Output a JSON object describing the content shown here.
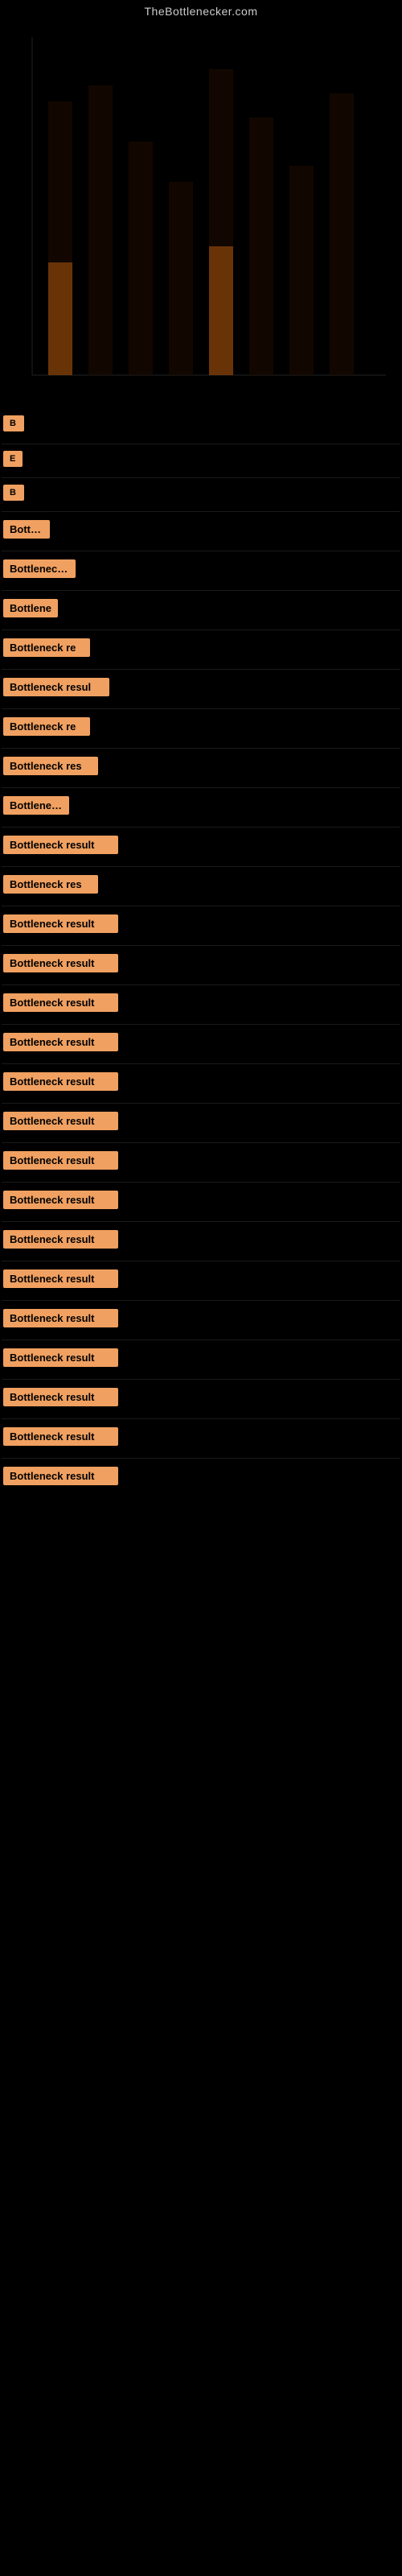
{
  "header": {
    "site_title": "TheBottlenecker.com"
  },
  "results": [
    {
      "id": 1,
      "label": "B",
      "width": 30,
      "visible_text": "B"
    },
    {
      "id": 2,
      "label": "E",
      "width": 28,
      "visible_text": "E"
    },
    {
      "id": 3,
      "label": "B",
      "width": 30,
      "visible_text": "B"
    },
    {
      "id": 4,
      "label": "Bottlen",
      "width": 60,
      "visible_text": "Bottlen"
    },
    {
      "id": 5,
      "label": "Bottleneck r",
      "width": 90,
      "visible_text": "Bottleneck r"
    },
    {
      "id": 6,
      "label": "Bottlene",
      "width": 68,
      "visible_text": "Bottlene"
    },
    {
      "id": 7,
      "label": "Bottleneck re",
      "width": 105,
      "visible_text": "Bottleneck re"
    },
    {
      "id": 8,
      "label": "Bottleneck resul",
      "width": 130,
      "visible_text": "Bottleneck resul"
    },
    {
      "id": 9,
      "label": "Bottleneck re",
      "width": 105,
      "visible_text": "Bottleneck re"
    },
    {
      "id": 10,
      "label": "Bottleneck res",
      "width": 115,
      "visible_text": "Bottleneck res"
    },
    {
      "id": 11,
      "label": "Bottleneck",
      "width": 82,
      "visible_text": "Bottleneck"
    },
    {
      "id": 12,
      "label": "Bottleneck result",
      "width": 140,
      "visible_text": "Bottleneck result"
    },
    {
      "id": 13,
      "label": "Bottleneck res",
      "width": 115,
      "visible_text": "Bottleneck res"
    },
    {
      "id": 14,
      "label": "Bottleneck result",
      "width": 140,
      "visible_text": "Bottleneck result"
    },
    {
      "id": 15,
      "label": "Bottleneck result",
      "width": 140,
      "visible_text": "Bottleneck result"
    },
    {
      "id": 16,
      "label": "Bottleneck result",
      "width": 140,
      "visible_text": "Bottleneck result"
    },
    {
      "id": 17,
      "label": "Bottleneck result",
      "width": 140,
      "visible_text": "Bottleneck result"
    },
    {
      "id": 18,
      "label": "Bottleneck result",
      "width": 140,
      "visible_text": "Bottleneck result"
    },
    {
      "id": 19,
      "label": "Bottleneck result",
      "width": 140,
      "visible_text": "Bottleneck result"
    },
    {
      "id": 20,
      "label": "Bottleneck result",
      "width": 140,
      "visible_text": "Bottleneck result"
    },
    {
      "id": 21,
      "label": "Bottleneck result",
      "width": 140,
      "visible_text": "Bottleneck result"
    },
    {
      "id": 22,
      "label": "Bottleneck result",
      "width": 140,
      "visible_text": "Bottleneck result"
    },
    {
      "id": 23,
      "label": "Bottleneck result",
      "width": 140,
      "visible_text": "Bottleneck result"
    },
    {
      "id": 24,
      "label": "Bottleneck result",
      "width": 140,
      "visible_text": "Bottleneck result"
    },
    {
      "id": 25,
      "label": "Bottleneck result",
      "width": 140,
      "visible_text": "Bottleneck result"
    },
    {
      "id": 26,
      "label": "Bottleneck result",
      "width": 140,
      "visible_text": "Bottleneck result"
    },
    {
      "id": 27,
      "label": "Bottleneck result",
      "width": 140,
      "visible_text": "Bottleneck result"
    },
    {
      "id": 28,
      "label": "Bottleneck result",
      "width": 140,
      "visible_text": "Bottleneck result"
    }
  ]
}
